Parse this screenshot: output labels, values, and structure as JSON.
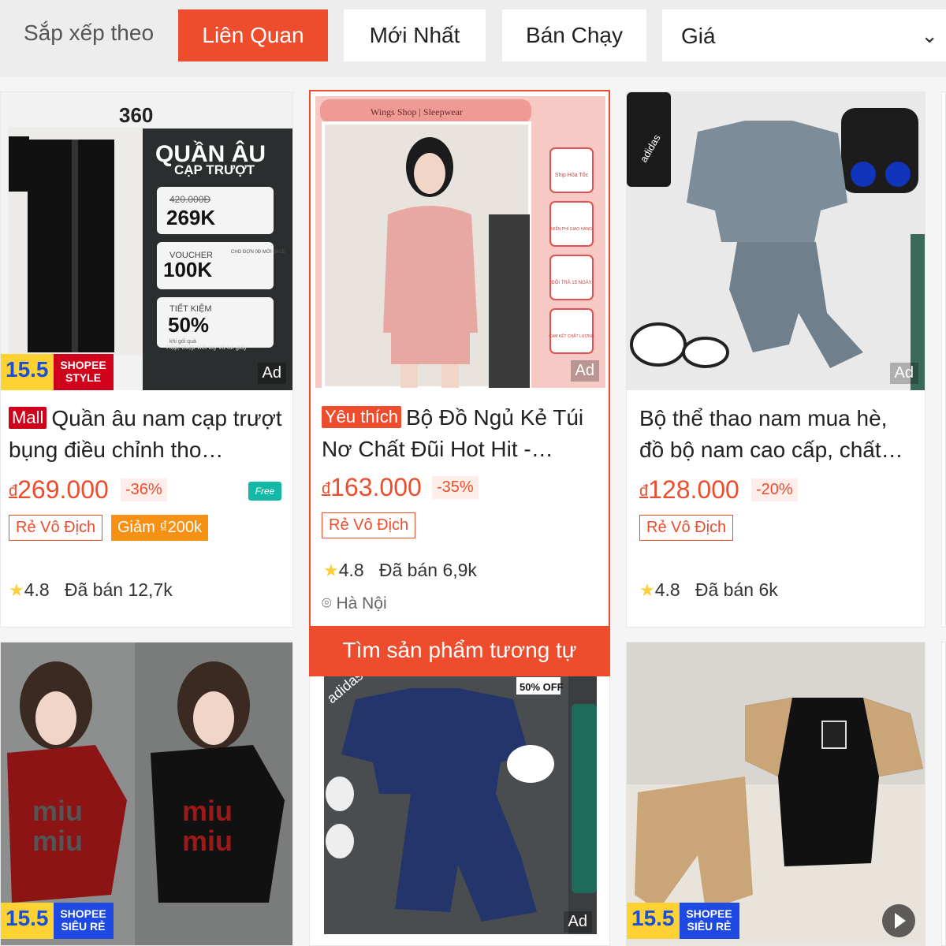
{
  "sortbar": {
    "label": "Sắp xếp theo",
    "options": [
      "Liên Quan",
      "Mới Nhất",
      "Bán Chạy"
    ],
    "active": "Liên Quan",
    "price_select": "Giá"
  },
  "products": [
    {
      "image_text": {
        "brand": "360",
        "headline": "QUẦN ÂU",
        "subhead": "CẠP TRƯỢT",
        "old_price": "420.000Đ",
        "new_price": "269K",
        "voucher_label": "VOUCHER",
        "voucher_value": "100K",
        "voucher_note": "CHO ĐƠN 0Đ MỚI SALE",
        "saving_label": "TIẾT KIỆM",
        "saving_value": "50%",
        "saving_note": "khi gói quà",
        "gift_note": "Hộp, thiệp viết tay và túi giấy"
      },
      "promo_num": "15.5",
      "promo_label": "SHOPEE STYLE",
      "ad": "Ad",
      "tag": "Mall",
      "title": "Quần âu nam cạp trượt bụng điều chỉnh tho…",
      "currency": "đ",
      "price": "269.000",
      "discount": "-36%",
      "free_ship": "Free",
      "badges": [
        "Rẻ Vô Địch",
        "Giảm ₫200k"
      ],
      "rating": "4.8",
      "sold": "Đã bán 12,7k"
    },
    {
      "image_text": {
        "shop": "Wings Shop | Sleepwear",
        "perks": [
          "Ship Hỏa Tốc",
          "MIỄN PHÍ GIAO HÀNG",
          "ĐỔI TRẢ 15 NGÀY",
          "CAM KẾT CHẤT LƯỢNG"
        ]
      },
      "ad": "Ad",
      "tag": "Yêu thích",
      "title": "Bộ Đồ Ngủ Kẻ Túi Nơ Chất Đũi Hot Hit -…",
      "currency": "đ",
      "price": "163.000",
      "discount": "-35%",
      "badges": [
        "Rẻ Vô Địch"
      ],
      "rating": "4.8",
      "sold": "Đã bán 6,9k",
      "location": "Hà Nội",
      "find_similar": "Tìm sản phẩm tương tự"
    },
    {
      "image_text": {
        "brand": "adidas"
      },
      "ad": "Ad",
      "title": "Bộ thể thao nam mua hè, đồ bộ nam cao cấp, chất…",
      "currency": "đ",
      "price": "128.000",
      "discount": "-20%",
      "badges": [
        "Rẻ Vô Địch"
      ],
      "rating": "4.8",
      "sold": "Đã bán 6k"
    },
    {
      "image_text": {
        "print_line1": "miu",
        "print_line2": "miu"
      },
      "promo_num": "15.5",
      "promo_label": "SHOPEE SIÊU RẺ"
    },
    {
      "image_text": {
        "brand": "adidas",
        "sale": "50% OFF"
      },
      "ad": "Ad"
    },
    {
      "promo_num": "15.5",
      "promo_label": "SHOPEE SIÊU RẺ"
    }
  ],
  "colors": {
    "accent": "#ee4d2d",
    "mall": "#d0011b",
    "star": "#ffce3d",
    "promo_yellow": "#ffd233",
    "promo_blue": "#1e49e2"
  }
}
